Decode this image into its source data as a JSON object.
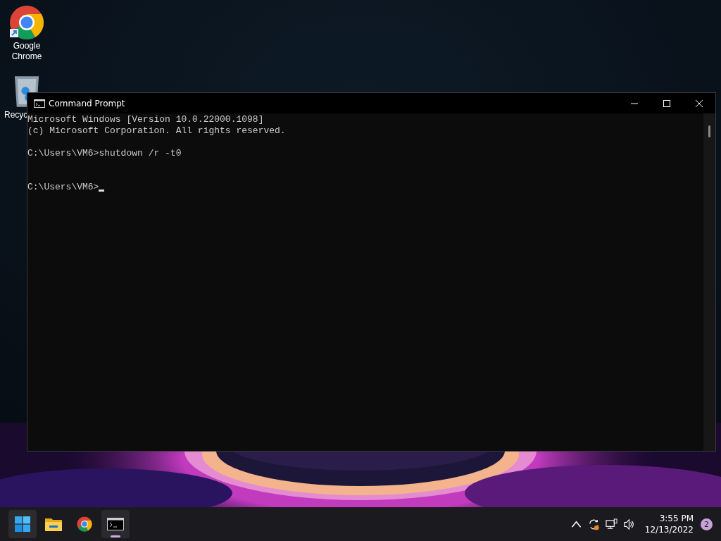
{
  "desktop_icons": [
    {
      "kind": "chrome",
      "label": "Google Chrome"
    },
    {
      "kind": "recycle",
      "label": "Recyc"
    }
  ],
  "window": {
    "title": "Command Prompt",
    "lines": [
      {
        "kind": "text",
        "text": "Microsoft Windows [Version 10.0.22000.1098]",
        "cursor": false
      },
      {
        "kind": "text",
        "text": "(c) Microsoft Corporation. All rights reserved.",
        "cursor": false
      },
      {
        "kind": "blank"
      },
      {
        "kind": "text",
        "text": "C:\\Users\\VM6>shutdown /r -t0",
        "cursor": false
      },
      {
        "kind": "blank"
      },
      {
        "kind": "blank"
      },
      {
        "kind": "text",
        "text": "C:\\Users\\VM6>",
        "cursor": true
      }
    ]
  },
  "taskbar": {
    "apps": [
      {
        "kind": "start",
        "hovered": true,
        "running": false
      },
      {
        "kind": "explorer",
        "hovered": false,
        "running": false
      },
      {
        "kind": "chrome",
        "hovered": false,
        "running": false
      },
      {
        "kind": "terminal",
        "hovered": false,
        "running": true
      }
    ],
    "clock": {
      "time": "3:55 PM",
      "date": "12/13/2022"
    },
    "notifications": "2"
  }
}
